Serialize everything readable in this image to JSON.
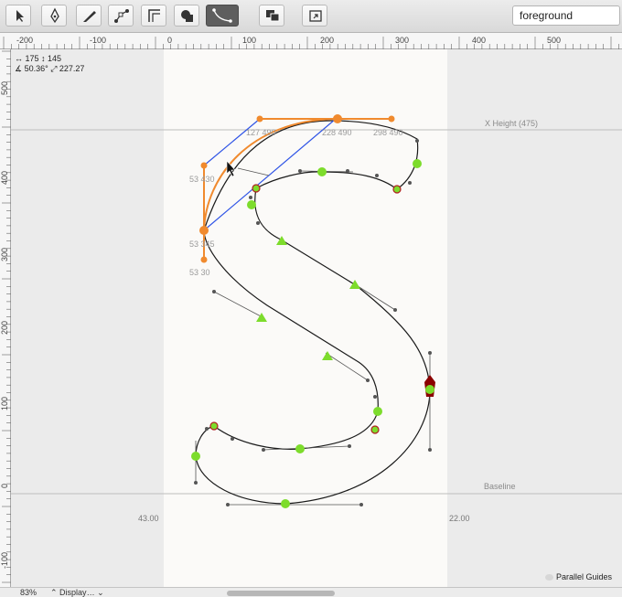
{
  "toolbar": {
    "tools": [
      {
        "name": "select-tool",
        "icon": "arrow-cursor-icon"
      },
      {
        "name": "pen-tool",
        "icon": "pen-nib-icon"
      },
      {
        "name": "knife-tool",
        "icon": "knife-icon"
      },
      {
        "name": "node-tool",
        "icon": "node-edit-icon"
      },
      {
        "name": "corner-tool",
        "icon": "corner-icon"
      },
      {
        "name": "shapes-tool",
        "icon": "shapes-icon"
      },
      {
        "name": "curve-tool",
        "icon": "curve-icon",
        "active": true
      },
      {
        "name": "overlap-tool",
        "icon": "overlap-squares-icon"
      },
      {
        "name": "rotate-tool",
        "icon": "rotate-icon"
      }
    ],
    "layer_value": "foreground"
  },
  "hruler": {
    "labels": [
      "-200",
      "-100",
      "0",
      "100",
      "200",
      "300",
      "400",
      "500"
    ]
  },
  "vruler": {
    "labels": [
      "500",
      "400",
      "300",
      "200",
      "100",
      "0",
      "-100"
    ]
  },
  "readout": {
    "line1": "↔ 175 ↕ 145",
    "line2": "∡ 50.36° ⤢ 227.27"
  },
  "guides": {
    "xheight": "X Height (475)",
    "baseline": "Baseline"
  },
  "point_labels": {
    "p1": "127 490",
    "p2": "228 490",
    "p3": "298 490",
    "p4": "53 430",
    "p5": "53 345",
    "p6": "53 30"
  },
  "sidebearings": {
    "left": "43.00",
    "right": "22.00"
  },
  "parallel_guides": "Parallel Guides",
  "status": {
    "zoom": "83%",
    "display": "Display"
  },
  "colors": {
    "orange": "#f08a2e",
    "green": "#7ddc2c",
    "blue": "#2f54e6",
    "dark_red": "#8b0000"
  }
}
